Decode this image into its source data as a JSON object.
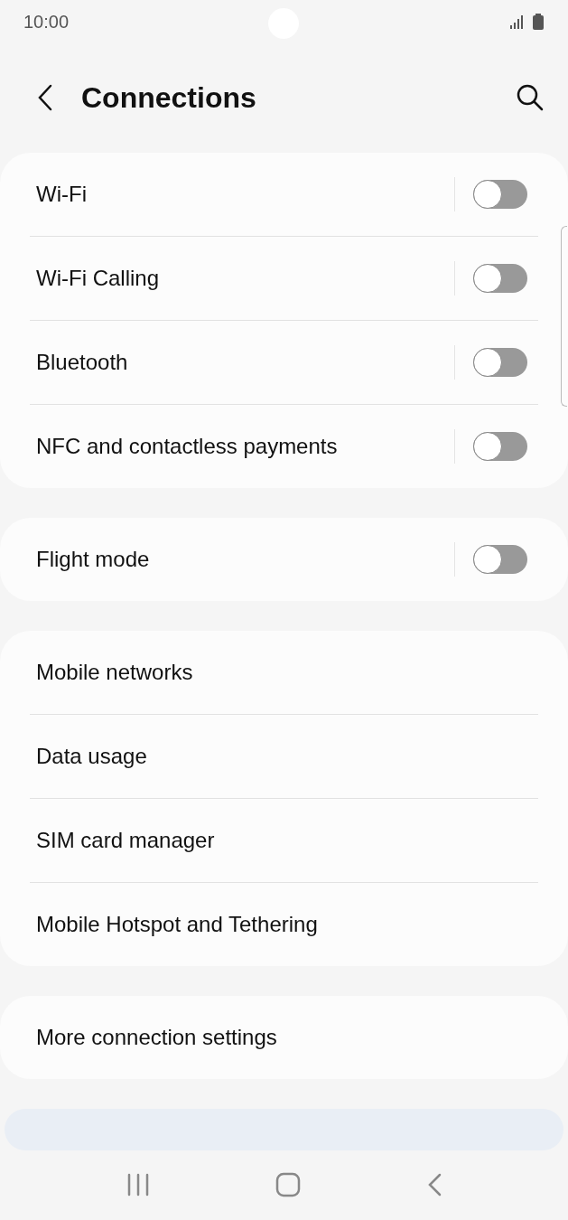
{
  "status_bar": {
    "time": "10:00"
  },
  "header": {
    "title": "Connections"
  },
  "groups": [
    {
      "items": [
        {
          "label": "Wi-Fi",
          "kind": "toggle",
          "on": false
        },
        {
          "label": "Wi-Fi Calling",
          "kind": "toggle",
          "on": false
        },
        {
          "label": "Bluetooth",
          "kind": "toggle",
          "on": false
        },
        {
          "label": "NFC and contactless payments",
          "kind": "toggle",
          "on": false
        }
      ]
    },
    {
      "items": [
        {
          "label": "Flight mode",
          "kind": "toggle",
          "on": false
        }
      ]
    },
    {
      "items": [
        {
          "label": "Mobile networks",
          "kind": "link"
        },
        {
          "label": "Data usage",
          "kind": "link"
        },
        {
          "label": "SIM card manager",
          "kind": "link"
        },
        {
          "label": "Mobile Hotspot and Tethering",
          "kind": "link"
        }
      ]
    },
    {
      "items": [
        {
          "label": "More connection settings",
          "kind": "link"
        }
      ]
    }
  ]
}
